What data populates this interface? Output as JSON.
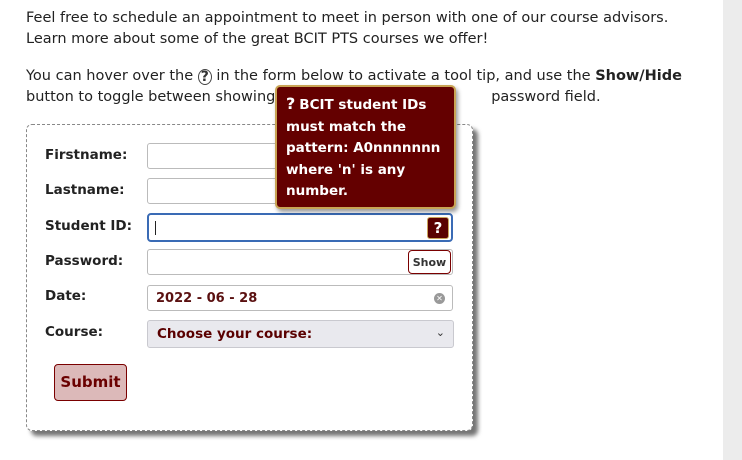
{
  "intro": {
    "paragraph1": "Feel free to schedule an appointment to meet in person with one of our course advisors. Learn more about some of the great BCIT PTS courses we offer!",
    "p2_before": "You can hover over the ",
    "p2_icon": "?",
    "p2_mid": " in the form below to activate a tool tip, and use the ",
    "p2_bold": "Show/Hide",
    "p2_after_bold": " button to toggle between showing or not sh",
    "p2_end": "password field."
  },
  "form": {
    "firstname_label": "Firstname:",
    "firstname_value": "",
    "lastname_label": "Lastname:",
    "lastname_value": "",
    "studentid_label": "Student ID:",
    "studentid_value": "",
    "studentid_help": "?",
    "password_label": "Password:",
    "password_value": "",
    "show_button": "Show",
    "date_label": "Date:",
    "date_value": "2022 - 06 - 28",
    "course_label": "Course:",
    "course_selected": "Choose your course:",
    "submit_label": "Submit"
  },
  "tooltip": {
    "icon": "?",
    "text": "BCIT student IDs must match the pattern: A0nnnnnnn where 'n' is any number."
  },
  "colors": {
    "accent": "#640000",
    "tooltip_border": "#c9a455",
    "submit_bg": "#dcb9b9",
    "focus_border": "#3a6bb5"
  },
  "icons": {
    "help": "question-mark-icon",
    "clear": "clear-x-icon",
    "dropdown": "chevron-down-icon"
  }
}
